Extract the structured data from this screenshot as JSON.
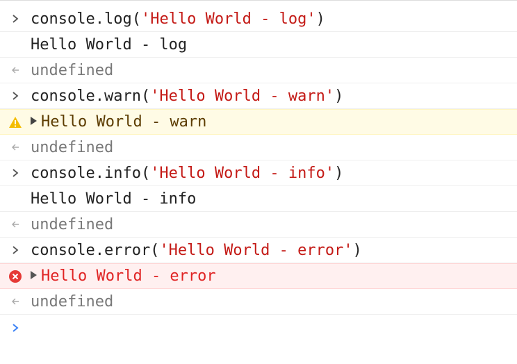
{
  "colors": {
    "string": "#c41a16",
    "result": "#787878",
    "warn_bg": "#fffbe5",
    "warn_text": "#5c3c00",
    "error_bg": "#fff0f0",
    "error_text": "#e02424",
    "prompt_caret": "#3b82f6"
  },
  "entries": [
    {
      "kind": "input",
      "icon": "input-caret-icon",
      "code_prefix": "console.log(",
      "code_string": "'Hello World - log'",
      "code_suffix": ")"
    },
    {
      "kind": "log",
      "icon": "",
      "text": "Hello World - log"
    },
    {
      "kind": "result",
      "icon": "result-arrow-icon",
      "text": "undefined"
    },
    {
      "kind": "input",
      "icon": "input-caret-icon",
      "code_prefix": "console.warn(",
      "code_string": "'Hello World - warn'",
      "code_suffix": ")"
    },
    {
      "kind": "warn",
      "icon": "warning-icon",
      "text": "Hello World - warn"
    },
    {
      "kind": "result",
      "icon": "result-arrow-icon",
      "text": "undefined"
    },
    {
      "kind": "input",
      "icon": "input-caret-icon",
      "code_prefix": "console.info(",
      "code_string": "'Hello World - info'",
      "code_suffix": ")"
    },
    {
      "kind": "log",
      "icon": "",
      "text": "Hello World - info"
    },
    {
      "kind": "result",
      "icon": "result-arrow-icon",
      "text": "undefined"
    },
    {
      "kind": "input",
      "icon": "input-caret-icon",
      "code_prefix": "console.error(",
      "code_string": "'Hello World - error'",
      "code_suffix": ")"
    },
    {
      "kind": "error",
      "icon": "error-icon",
      "text": "Hello World - error"
    },
    {
      "kind": "result",
      "icon": "result-arrow-icon",
      "text": "undefined"
    }
  ],
  "prompt": {
    "icon": "prompt-caret-icon",
    "value": ""
  }
}
